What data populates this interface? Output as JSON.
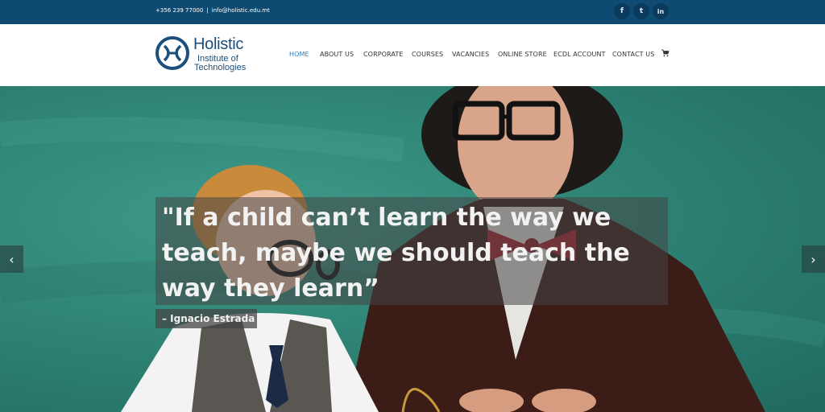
{
  "topbar": {
    "phone": "+356 239 77000",
    "separator": "|",
    "email": "info@holistic.edu.mt",
    "social": [
      "facebook-icon",
      "twitter-icon",
      "linkedin-icon"
    ],
    "social_glyphs": {
      "facebook": "f",
      "twitter": "t",
      "linkedin": "in"
    },
    "background": "#0f4a73"
  },
  "logo": {
    "line1": "Holistic",
    "line2": "Institute of",
    "line3": "Technologies",
    "color": "#1b4f7c"
  },
  "nav": {
    "items": [
      {
        "label": "HOME",
        "active": true
      },
      {
        "label": "ABOUT US",
        "active": false
      },
      {
        "label": "CORPORATE",
        "active": false
      },
      {
        "label": "COURSES",
        "active": false
      },
      {
        "label": "VACANCIES",
        "active": false
      },
      {
        "label": "ONLINE STORE",
        "active": false
      },
      {
        "label": "ECDL ACCOUNT",
        "active": false
      },
      {
        "label": "CONTACT US",
        "active": false
      }
    ],
    "cart_icon": "cart-icon",
    "active_color": "#2c7fb8"
  },
  "slider": {
    "quote": "\"If a child can’t learn the way we teach, maybe we should teach the way they learn”",
    "author": "– Ignacio Estrada",
    "prev_glyph": "‹",
    "next_glyph": "›"
  }
}
